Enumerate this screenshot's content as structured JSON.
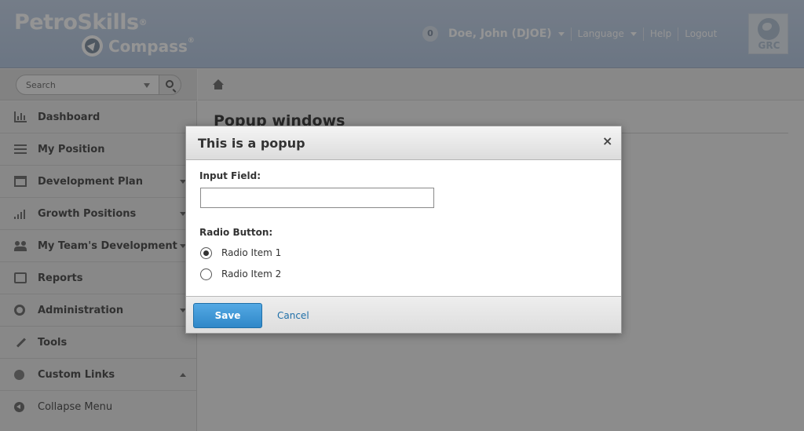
{
  "header": {
    "logo_top": "PetroSkills",
    "logo_top_mark": "®",
    "logo_bottom": "Compass",
    "logo_bottom_mark": "®",
    "notification_count": "0",
    "user_name": "Doe, John (DJOE)",
    "language_label": "Language",
    "help_label": "Help",
    "logout_label": "Logout",
    "grc_label": "GRC"
  },
  "search": {
    "placeholder": "Search"
  },
  "sidebar": {
    "items": [
      {
        "label": "Dashboard",
        "icon": "bar-chart-icon",
        "has_arrow": false
      },
      {
        "label": "My Position",
        "icon": "list-icon",
        "has_arrow": false
      },
      {
        "label": "Development Plan",
        "icon": "calendar-icon",
        "has_arrow": true
      },
      {
        "label": "Growth Positions",
        "icon": "signal-icon",
        "has_arrow": true
      },
      {
        "label": "My Team's Development",
        "icon": "people-icon",
        "has_arrow": true
      },
      {
        "label": "Reports",
        "icon": "printer-icon",
        "has_arrow": false
      },
      {
        "label": "Administration",
        "icon": "gear-icon",
        "has_arrow": true
      },
      {
        "label": "Tools",
        "icon": "wrench-icon",
        "has_arrow": false
      },
      {
        "label": "Custom Links",
        "icon": "globe-icon",
        "has_arrow": true
      }
    ],
    "collapse_label": "Collapse Menu"
  },
  "main": {
    "page_title": "Popup windows"
  },
  "popup": {
    "title": "This is a popup",
    "close_glyph": "×",
    "input_label": "Input Field:",
    "input_value": "",
    "radio_label": "Radio Button:",
    "radio_items": [
      {
        "label": "Radio Item 1",
        "checked": true
      },
      {
        "label": "Radio Item 2",
        "checked": false
      }
    ],
    "save_label": "Save",
    "cancel_label": "Cancel"
  },
  "colors": {
    "header_bg": "#c9d7ea",
    "overlay": "#000000",
    "primary_button": "#3a92d2",
    "link": "#1f6fa8"
  }
}
